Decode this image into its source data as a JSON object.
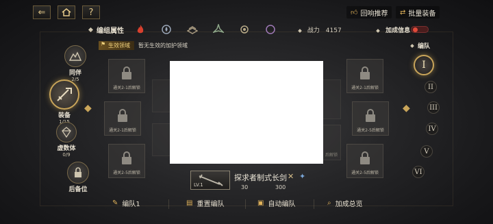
{
  "topbar": {
    "back_icon": "back-arrow-icon",
    "home_icon": "home-icon",
    "help_label": "?",
    "recommend_label": "回响推荐",
    "batch_equip_label": "批量装备"
  },
  "element_bar": {
    "label": "编组属性",
    "elements": [
      "fire",
      "water",
      "earth",
      "wind",
      "light",
      "dark"
    ],
    "power_label": "战力",
    "power_value": "4157",
    "bonus_label": "加成信息"
  },
  "domain": {
    "tag": "生效领域",
    "text": "暂无生效的加护领域"
  },
  "nav": [
    {
      "label": "同伴",
      "count": "2/5"
    },
    {
      "label": "装备",
      "count": "1/15"
    },
    {
      "label": "虚数体",
      "count": "0/9"
    },
    {
      "label": "后备位",
      "count": ""
    }
  ],
  "slots": {
    "left_top": "通关2-1后解锁",
    "left_mid": "通关2-1后解锁",
    "left_bottom": "通关2-5后解锁",
    "right_top": "通关2-1后解锁",
    "right_mid": "通关2-5后解锁",
    "right_bottom": "通关2-5后解锁",
    "right_inner": "后解锁"
  },
  "weapon": {
    "level": "LV.1",
    "name": "探求者制式长剑",
    "stat_1": "30",
    "stat_2": "300"
  },
  "team": {
    "title": "编队",
    "numerals": [
      "I",
      "II",
      "III",
      "IV",
      "V",
      "VI"
    ],
    "active_index": 0
  },
  "bottom": {
    "edit_label": "编队1",
    "reset_label": "重置编队",
    "auto_label": "自动编队",
    "overview_label": "加成总览"
  },
  "colors": {
    "accent_gold": "#c9a55a",
    "fire": "#d8402e",
    "toggle_red": "#e04a3a"
  }
}
